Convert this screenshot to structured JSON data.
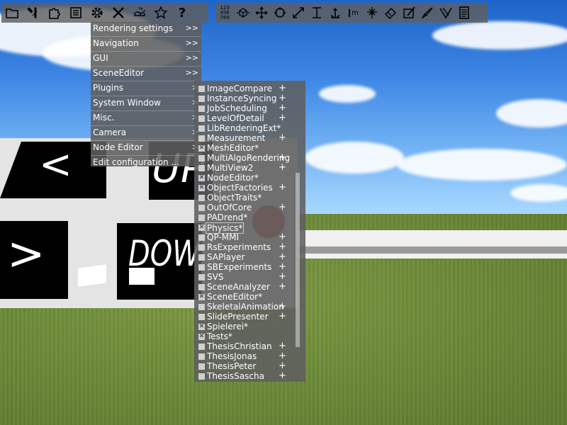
{
  "toolbar_left": [
    {
      "icon": "folder-icon"
    },
    {
      "icon": "tools-icon"
    },
    {
      "icon": "puzzle-icon"
    },
    {
      "icon": "document-list-icon"
    },
    {
      "icon": "gear-icon"
    },
    {
      "icon": "wrench-hammer-icon"
    },
    {
      "icon": "weather-icon"
    },
    {
      "icon": "star-icon"
    },
    {
      "icon": "help-icon",
      "glyph": "?"
    }
  ],
  "toolbar_right": [
    {
      "icon": "numbers-grid-icon",
      "glyph": "123\n456\n789"
    },
    {
      "icon": "cube-transform-icon"
    },
    {
      "icon": "move-icon"
    },
    {
      "icon": "rotate-icon"
    },
    {
      "icon": "scale-icon"
    },
    {
      "icon": "align-icon"
    },
    {
      "icon": "anchor-icon"
    },
    {
      "icon": "measure-icon",
      "glyph": "m"
    },
    {
      "icon": "node-icon"
    },
    {
      "icon": "paint-icon"
    },
    {
      "icon": "paint-area-icon"
    },
    {
      "icon": "brush-icon"
    },
    {
      "icon": "eraser-icon"
    },
    {
      "icon": "notes-icon"
    }
  ],
  "main_menu": {
    "items": [
      {
        "label": "Rendering settings",
        "arrow": ">>"
      },
      {
        "label": "Navigation",
        "arrow": ">>"
      },
      {
        "label": "GUI",
        "arrow": ">>"
      },
      {
        "label": "SceneEditor",
        "arrow": ">>"
      },
      {
        "label": "Plugins",
        "arrow": ">"
      },
      {
        "label": "System Window",
        "arrow": ">"
      },
      {
        "label": "Misc.",
        "arrow": ">"
      },
      {
        "label": "Camera",
        "arrow": ">"
      },
      {
        "label": "Node Editor",
        "arrow": ">"
      },
      {
        "label": "Edit configuration ...",
        "arrow": ""
      }
    ]
  },
  "plugins_menu": {
    "items": [
      {
        "label": "ImageCompare",
        "checked": false,
        "plus": "+"
      },
      {
        "label": "InstanceSyncing",
        "checked": false,
        "plus": "+"
      },
      {
        "label": "JobScheduling",
        "checked": false,
        "plus": "+"
      },
      {
        "label": "LevelOfDetail",
        "checked": false,
        "plus": "+"
      },
      {
        "label": "LibRenderingExt*",
        "checked": false,
        "plus": ""
      },
      {
        "label": "Measurement",
        "checked": false,
        "plus": "+"
      },
      {
        "label": "MeshEditor*",
        "checked": true,
        "plus": ""
      },
      {
        "label": "MultiAlgoRendering",
        "checked": false,
        "plus": "+"
      },
      {
        "label": "MultiView2",
        "checked": false,
        "plus": "+"
      },
      {
        "label": "NodeEditor*",
        "checked": true,
        "plus": ""
      },
      {
        "label": "ObjectFactories",
        "checked": true,
        "plus": "+"
      },
      {
        "label": "ObjectTraits*",
        "checked": false,
        "plus": ""
      },
      {
        "label": "OutOfCore",
        "checked": false,
        "plus": "+"
      },
      {
        "label": "PADrend*",
        "checked": false,
        "plus": ""
      },
      {
        "label": "Physics*",
        "checked": true,
        "plus": "",
        "selected": true
      },
      {
        "label": "QP-MMI",
        "checked": false,
        "plus": "+"
      },
      {
        "label": "RsExperiments",
        "checked": false,
        "plus": "+"
      },
      {
        "label": "SAPlayer",
        "checked": false,
        "plus": "+"
      },
      {
        "label": "SBExperiments",
        "checked": false,
        "plus": "+"
      },
      {
        "label": "SVS",
        "checked": false,
        "plus": "+"
      },
      {
        "label": "SceneAnalyzer",
        "checked": false,
        "plus": "+"
      },
      {
        "label": "SceneEditor*",
        "checked": true,
        "plus": ""
      },
      {
        "label": "SkeletalAnimation",
        "checked": false,
        "plus": "+"
      },
      {
        "label": "SlidePresenter",
        "checked": false,
        "plus": "+"
      },
      {
        "label": "Spielerei*",
        "checked": true,
        "plus": ""
      },
      {
        "label": "Tests*",
        "checked": true,
        "plus": ""
      },
      {
        "label": "ThesisChristian",
        "checked": false,
        "plus": "+"
      },
      {
        "label": "ThesisJonas",
        "checked": false,
        "plus": "+"
      },
      {
        "label": "ThesisPeter",
        "checked": false,
        "plus": "+"
      },
      {
        "label": "ThesisSascha",
        "checked": false,
        "plus": "+"
      }
    ]
  },
  "scene": {
    "tile_left_top": "<",
    "tile_up": "UP",
    "tile_left_bottom": ">",
    "tile_down": "DOWN"
  }
}
